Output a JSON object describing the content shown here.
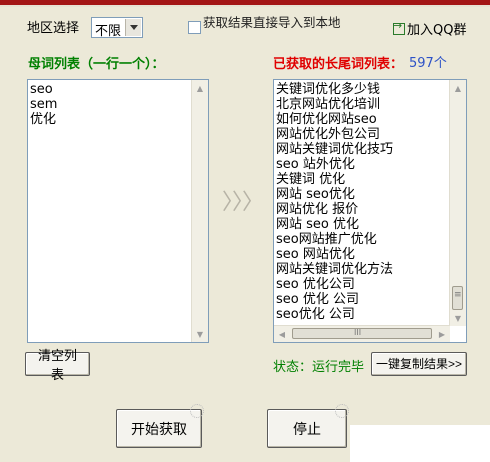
{
  "region": {
    "label": "地区选择",
    "selected": "不限"
  },
  "import_option": {
    "label": "获取结果直接导入到本地",
    "checked": false
  },
  "qq_group_link": "加入QQ群",
  "left_panel": {
    "title": "母词列表（一行一个）：",
    "lines": [
      "seo",
      "sem",
      "优化"
    ]
  },
  "right_panel": {
    "title": "已获取的长尾词列表：",
    "count": "597个",
    "lines": [
      "关键词优化多少钱",
      "北京网站优化培训",
      "如何优化网站seo",
      "网站优化外包公司",
      "网站关键词优化技巧",
      "seo 站外优化",
      "关键词 优化",
      "网站 seo优化",
      "网站优化 报价",
      "网站 seo 优化",
      "seo网站推广优化",
      "seo 网站优化",
      "网站关键词优化方法",
      "seo 优化公司",
      "seo 优化 公司",
      "seo优化 公司"
    ]
  },
  "arrows": "〉〉〉",
  "clear_button": "清空列表",
  "status": {
    "text": "状态：运行完毕"
  },
  "copy_button": "一键复制结果>>",
  "start_button": "开始获取",
  "stop_button": "停止",
  "scroll_glyphs": {
    "up": "▲",
    "down": "▼",
    "left": "◀",
    "right": "▶",
    "grip_v": "≡",
    "grip_h": "III"
  }
}
